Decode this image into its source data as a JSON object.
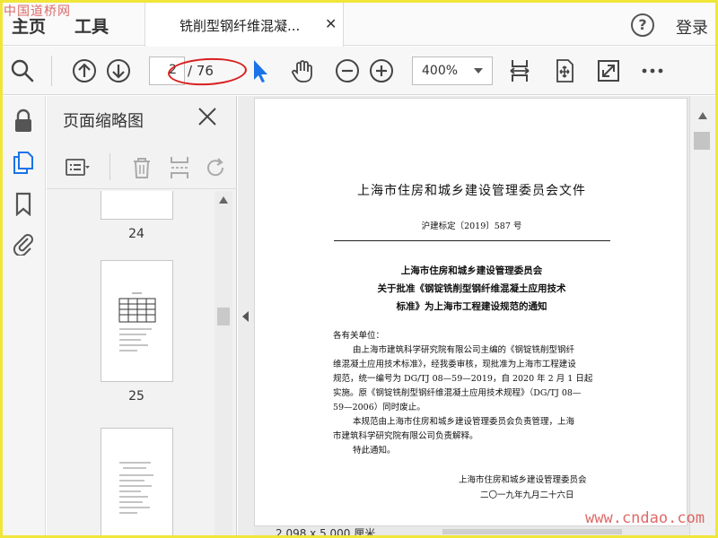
{
  "watermarks": {
    "top_left": "中国道桥网",
    "bottom_right": "www.cndao.com"
  },
  "menubar": {
    "home_label": "主页",
    "tools_label": "工具",
    "doc_tab_title": "铣削型钢纤维混凝...",
    "close_glyph": "✕",
    "help_glyph": "?",
    "login_label": "登录"
  },
  "toolbar": {
    "current_page": "2",
    "total_pages": "/ 76",
    "zoom_value": "400%"
  },
  "panel": {
    "title": "页面缩略图",
    "thumbnails": [
      {
        "number": "24"
      },
      {
        "number": "25"
      }
    ]
  },
  "document": {
    "header": "上海市住房和城乡建设管理委员会文件",
    "doc_number": "沪建标定〔2019〕587 号",
    "title_lines": [
      "上海市住房和城乡建设管理委员会",
      "关于批准《钢锭铣削型钢纤维混凝土应用技术",
      "标准》为上海市工程建设规范的通知"
    ],
    "salutation": "各有关单位：",
    "body_lines": [
      "由上海市建筑科学研究院有限公司主编的《钢锭铣削型钢纤",
      "维混凝土应用技术标准》，经我委审核，现批准为上海市工程建设",
      "规范，统一编号为 DG/TJ 08—59—2019，自 2020 年 2 月 1 日起",
      "实施。原《钢锭铣削型钢纤维混凝土应用技术规程》（DG/TJ 08—",
      "59—2006）同时废止。",
      "本规范由上海市住房和城乡建设管理委员会负责管理，上海",
      "市建筑科学研究院有限公司负责解释。",
      "特此通知。"
    ],
    "signature": "上海市住房和城乡建设管理委员会",
    "date": "二〇一九年九月二十六日"
  },
  "status": {
    "page_size": "2.098 x 5.000 厘米"
  }
}
